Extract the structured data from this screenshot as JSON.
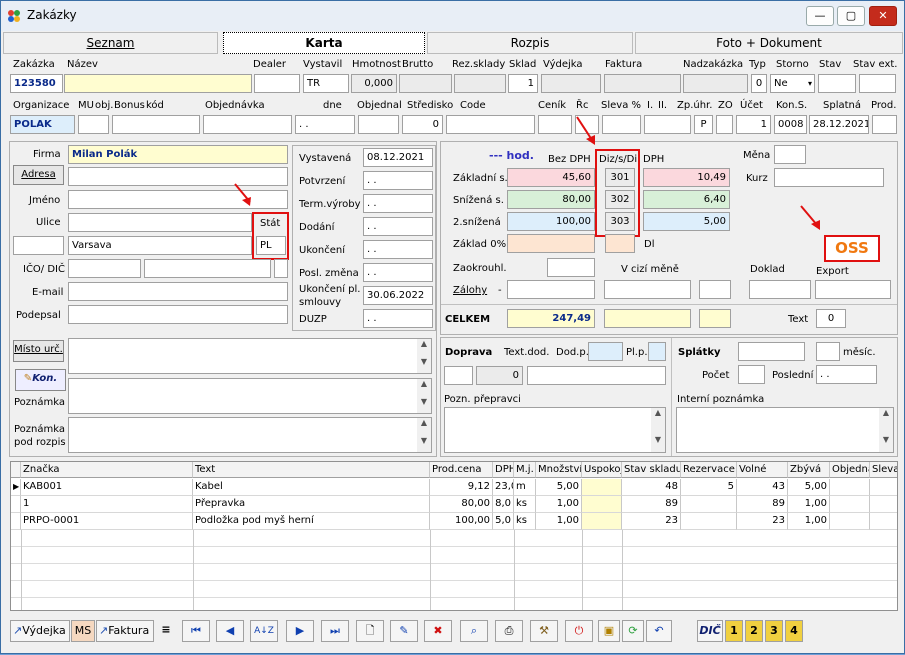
{
  "window": {
    "title": "Zakázky",
    "minimize": "—",
    "maximize": "▢",
    "close": "✕"
  },
  "tabs": [
    "Seznam",
    "Karta",
    "Rozpis",
    "Foto + Dokument"
  ],
  "row1": {
    "labels": [
      "Zakázka",
      "Název",
      "Dealer",
      "Vystavil",
      "Hmotnost",
      "Brutto",
      "Rez.sklady",
      "Sklad",
      "Výdejka",
      "Faktura",
      "Nadzakázka",
      "Typ",
      "Storno",
      "Stav",
      "Stav ext."
    ],
    "zakazka": "123580",
    "vystavil": "TR",
    "hmotnost": "0,000",
    "sklad": "1",
    "typ": "0",
    "storno": "Ne"
  },
  "row2": {
    "labels": [
      "Organizace",
      "MU",
      "obj.",
      "Bonus",
      "kód",
      "Objednávka",
      "dne",
      "Objednal",
      "Středisko",
      "Code",
      "Ceník",
      "Řc",
      "Sleva %",
      "I.",
      "II.",
      "Zp.úhr.",
      "ZO",
      "Účet",
      "Kon.S.",
      "Splatná",
      "Prod."
    ],
    "organizace": "POLAK",
    "dne": ". .",
    "stredisko": "0",
    "zp_uhr": "P",
    "ucet": "1",
    "kon_s": "0008",
    "splatna": "28.12.2021"
  },
  "address": {
    "firma_label": "Firma",
    "firma": "Milan Polák",
    "adresa_button": "Adresa",
    "jmeno_label": "Jméno",
    "ulice_label": "Ulice",
    "stat_label": "Stát",
    "stat": "PL",
    "city": "Varsava",
    "ico_label": "IČO/ DIČ",
    "email_label": "E-mail",
    "podepsal_label": "Podepsal"
  },
  "dates": {
    "vystavena_label": "Vystavená",
    "vystavena": "08.12.2021",
    "potvrzeni_label": "Potvrzení",
    "potvrzeni": ". .",
    "term_label": "Term.výroby",
    "term": ". .",
    "dodani_label": "Dodání",
    "dodani": ". .",
    "ukonceni_label": "Ukončení",
    "ukonceni": ". .",
    "posl_label": "Posl. změna",
    "posl": ". .",
    "ukonceni_pl_label1": "Ukončení pl.",
    "ukonceni_pl_label2": "smlouvy",
    "ukonceni_pl": "30.06.2022",
    "duzp_label": "DUZP",
    "duzp": ". ."
  },
  "notes": {
    "misto_button": "Místo urč.",
    "kon_button": "Kon.",
    "poznamka_label": "Poznámka",
    "poznamka_rozpis_label1": "Poznámka",
    "poznamka_rozpis_label2": "pod rozpis"
  },
  "vat": {
    "hod_label": "--- hod.",
    "bez_dph_label": "Bez DPH",
    "diz_label": "Diz/s/Di",
    "dph_label": "DPH",
    "zakladni_label": "Základní s.",
    "snizena_label": "Snížená s.",
    "snizena2_label": "2.snížená",
    "zaklad0_label": "Základ 0%",
    "zaokrouhl_label": "Zaokrouhl.",
    "zalohy_label": "Zálohy",
    "zalohy_dash": "-",
    "di_label": "Dl",
    "rows": [
      {
        "bez": "45,60",
        "code": "301",
        "dph": "10,49"
      },
      {
        "bez": "80,00",
        "code": "302",
        "dph": "6,40"
      },
      {
        "bez": "100,00",
        "code": "303",
        "dph": "5,00"
      }
    ],
    "mena_label": "Měna",
    "kurz_label": "Kurz",
    "oss": "OSS",
    "v_cizi_mene_label": "V cizí měně",
    "doklad_label": "Doklad",
    "export_label": "Export",
    "celkem_label": "CELKEM",
    "celkem": "247,49",
    "text_label": "Text",
    "text_value": "0"
  },
  "doprava": {
    "doprava_label": "Doprava",
    "text_dod_label": "Text.dod.",
    "dod_p_label": "Dod.p.",
    "pl_p_label": "Pl.p.",
    "dod_value": "0",
    "splatky_label": "Splátky",
    "mesic_label": "měsíc.",
    "pocet_label": "Počet",
    "posledni_label": "Poslední",
    "posledni": ". .",
    "pozn_prepravci_label": "Pozn. přepravci",
    "interni_label": "Interní poznámka"
  },
  "grid": {
    "headers": [
      "Značka",
      "Text",
      "Prod.cena",
      "DPH",
      "M.j.",
      "Množství",
      "Uspokoj",
      "Stav skladu",
      "Rezervace",
      "Volné",
      "Zbývá",
      "Objedná",
      "Sleva"
    ],
    "rows": [
      {
        "znacka": "KAB001",
        "text": "Kabel",
        "cena": "9,12",
        "dph": "23,0",
        "mj": "m",
        "mnozstvi": "5,00",
        "stav": "48",
        "rez": "5",
        "volne": "43",
        "zbyva": "5,00"
      },
      {
        "znacka": "1",
        "text": "Přepravka",
        "cena": "80,00",
        "dph": "8,0",
        "mj": "ks",
        "mnozstvi": "1,00",
        "stav": "89",
        "rez": "",
        "volne": "89",
        "zbyva": "1,00"
      },
      {
        "znacka": "PRPO-0001",
        "text": "Podložka pod myš herní",
        "cena": "100,00",
        "dph": "5,0",
        "mj": "ks",
        "mnozstvi": "1,00",
        "stav": "23",
        "rez": "",
        "volne": "23",
        "zbyva": "1,00"
      }
    ]
  },
  "toolbar": {
    "vydejka": "Výdejka",
    "ms": "MS",
    "faktura": "Faktura",
    "dic": "DIČ",
    "nums": [
      "1",
      "2",
      "3",
      "4"
    ]
  }
}
